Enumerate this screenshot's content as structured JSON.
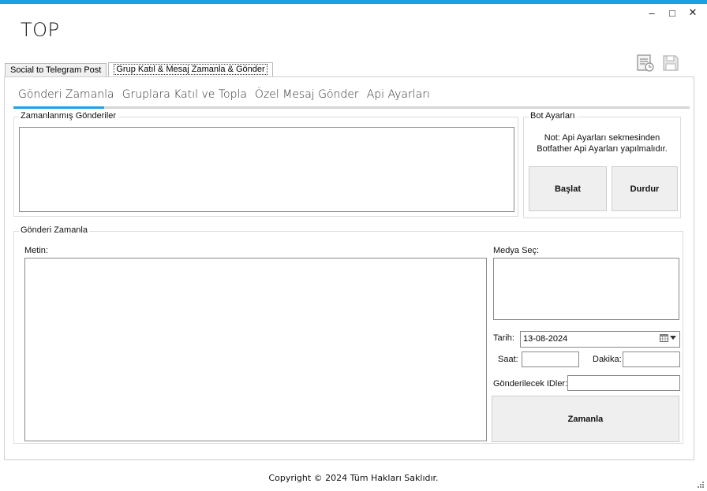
{
  "window": {
    "title": "TOP",
    "accent_color": "#1ba1e2",
    "controls": {
      "minimize": "–",
      "maximize": "□",
      "close": "✕"
    }
  },
  "toolbar": {
    "icons": [
      "report-icon",
      "save-icon"
    ]
  },
  "outer_tabs": [
    {
      "label": "Social to Telegram Post"
    },
    {
      "label": "Grup Katıl & Mesaj Zamanla & Gönder"
    }
  ],
  "inner_tabs": [
    {
      "label": "Gönderi Zamanla"
    },
    {
      "label": "Gruplara Katıl ve Topla"
    },
    {
      "label": "Özel Mesaj Gönder"
    },
    {
      "label": "Api Ayarları"
    }
  ],
  "scheduled_posts": {
    "title": "Zamanlanmış Gönderiler"
  },
  "bot_settings": {
    "title": "Bot Ayarları",
    "note_line1": "Not: Api Ayarları sekmesinden",
    "note_line2": "Botfather Api Ayarları yapılmalıdır.",
    "start_label": "Başlat",
    "stop_label": "Durdur"
  },
  "schedule_form": {
    "title": "Gönderi Zamanla",
    "text_label": "Metin:",
    "media_label": "Medya Seç:",
    "date_label": "Tarih:",
    "date_value": "13-08-2024",
    "hour_label": "Saat:",
    "minute_label": "Dakika:",
    "ids_label": "Gönderilecek IDler:",
    "schedule_button": "Zamanla"
  },
  "footer": {
    "copyright": "Copyright © 2024 Tüm Hakları Saklıdır."
  }
}
